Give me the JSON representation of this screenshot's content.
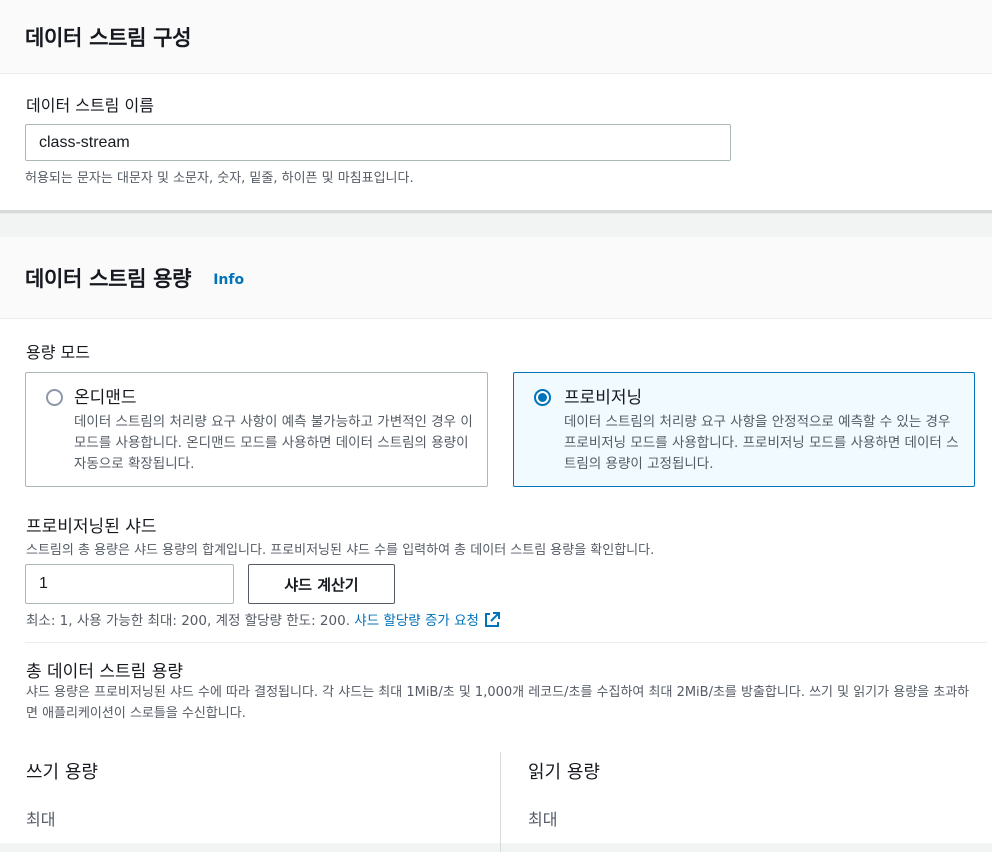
{
  "config_section": {
    "title": "데이터 스트림 구성",
    "name_label": "데이터 스트림 이름",
    "name_value": "class-stream",
    "name_hint": "허용되는 문자는 대문자 및 소문자, 숫자, 밑줄, 하이픈 및 마침표입니다."
  },
  "capacity_section": {
    "title": "데이터 스트림 용량",
    "info_link": "Info",
    "mode_label": "용량 모드",
    "modes": [
      {
        "title": "온디맨드",
        "description": "데이터 스트림의 처리량 요구 사항이 예측 불가능하고 가변적인 경우 이 모드를 사용합니다. 온디맨드 모드를 사용하면 데이터 스트림의 용량이 자동으로 확장됩니다.",
        "selected": false
      },
      {
        "title": "프로비저닝",
        "description": "데이터 스트림의 처리량 요구 사항을 안정적으로 예측할 수 있는 경우 프로비저닝 모드를 사용합니다. 프로비저닝 모드를 사용하면 데이터 스트림의 용량이 고정됩니다.",
        "selected": true
      }
    ],
    "shards_label": "프로비저닝된 샤드",
    "shards_desc": "스트림의 총 용량은 샤드 용량의 합계입니다. 프로비저닝된 샤드 수를 입력하여 총 데이터 스트림 용량을 확인합니다.",
    "shards_value": "1",
    "calc_button": "샤드 계산기",
    "limits_text": "최소: 1, 사용 가능한 최대: 200, 계정 할당량 한도: 200.",
    "quota_link": "샤드 할당량 증가 요청",
    "quota_icon": "external-link-icon",
    "total_label": "총 데이터 스트림 용량",
    "total_desc": "샤드 용량은 프로비저닝된 샤드 수에 따라 결정됩니다. 각 샤드는 최대 1MiB/초 및 1,000개 레코드/초를 수집하여 최대 2MiB/초를 방출합니다. 쓰기 및 읽기가 용량을 초과하면 애플리케이션이 스로틀을 수신합니다.",
    "write_capacity": {
      "title": "쓰기 용량",
      "max_label": "최대"
    },
    "read_capacity": {
      "title": "읽기 용량",
      "max_label": "최대"
    }
  },
  "colors": {
    "accent": "#0073bb",
    "selected_bg": "#f1faff",
    "secondary_text": "#545b64",
    "page_bg": "#f2f3f3"
  }
}
